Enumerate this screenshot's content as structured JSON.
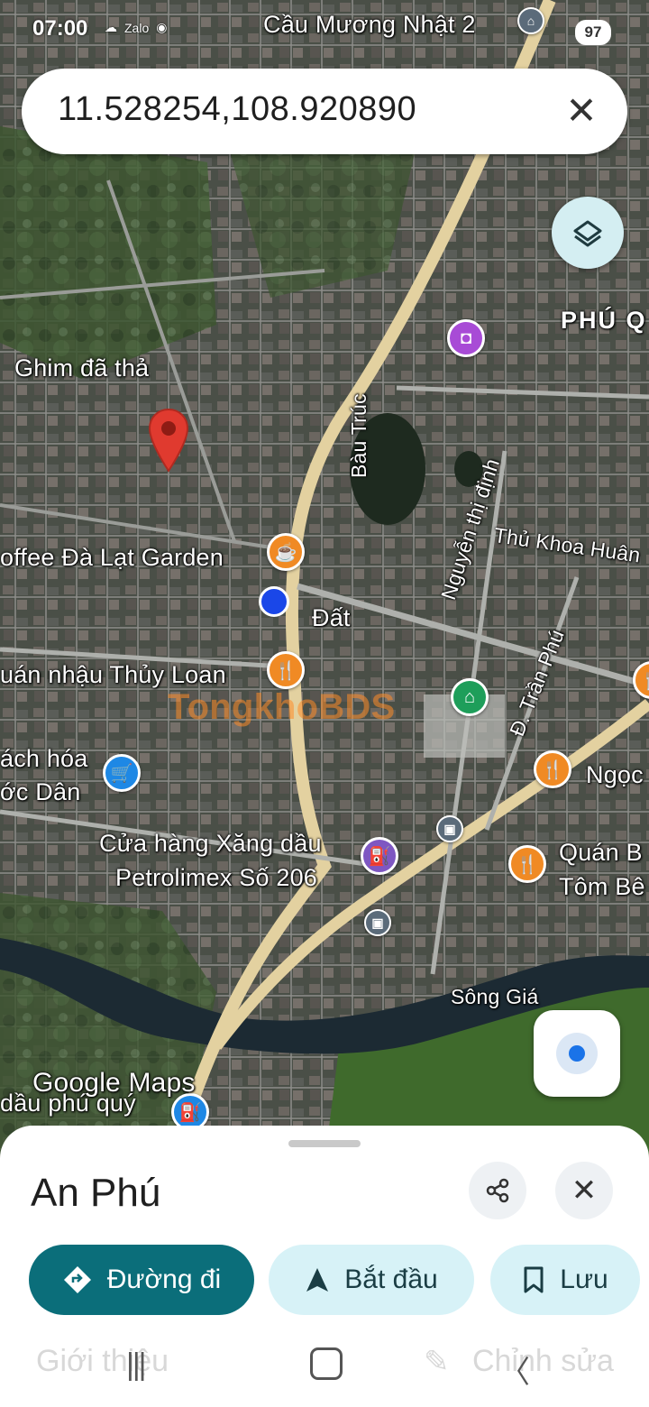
{
  "status_bar": {
    "time": "07:00",
    "icons": [
      "cloud-icon",
      "zalo-icon",
      "globe-icon"
    ],
    "battery": "97"
  },
  "search": {
    "query": "11.528254,108.920890"
  },
  "map_labels": {
    "top_place": "Cầu Mương Nhật 2",
    "district": "PHÚ Q",
    "dropped_pin": "Ghim đã thả",
    "lake": "Bàu Trúc",
    "street_nguyen": "Nguyễn thị định",
    "street_thu_khoa": "Thủ Khoa Huân",
    "coffee": "offee Đà Lạt Garden",
    "dat": "Đất",
    "quan_nhau": "uán nhậu Thủy Loan",
    "tran_phu": "Đ. Trần Phú",
    "bach_hoa_1": "ách hóa",
    "bach_hoa_2": "ớc Dân",
    "ngoc": "Ngọc",
    "gas_1": "Cửa hàng Xăng dầu",
    "gas_2": "Petrolimex Số 206",
    "quan_b_1": "Quán B",
    "quan_b_2": "Tôm Bê",
    "river": "Sông Giá",
    "bottom_road": "dầu phú quý",
    "watermark": "TongkhoBDS",
    "google": "Google Maps"
  },
  "sheet": {
    "title": "An Phú",
    "directions": "Đường đi",
    "start": "Bắt đầu",
    "save": "Lưu",
    "tab_about": "Giới thiệu",
    "tab_edit": "Chỉnh sửa"
  }
}
